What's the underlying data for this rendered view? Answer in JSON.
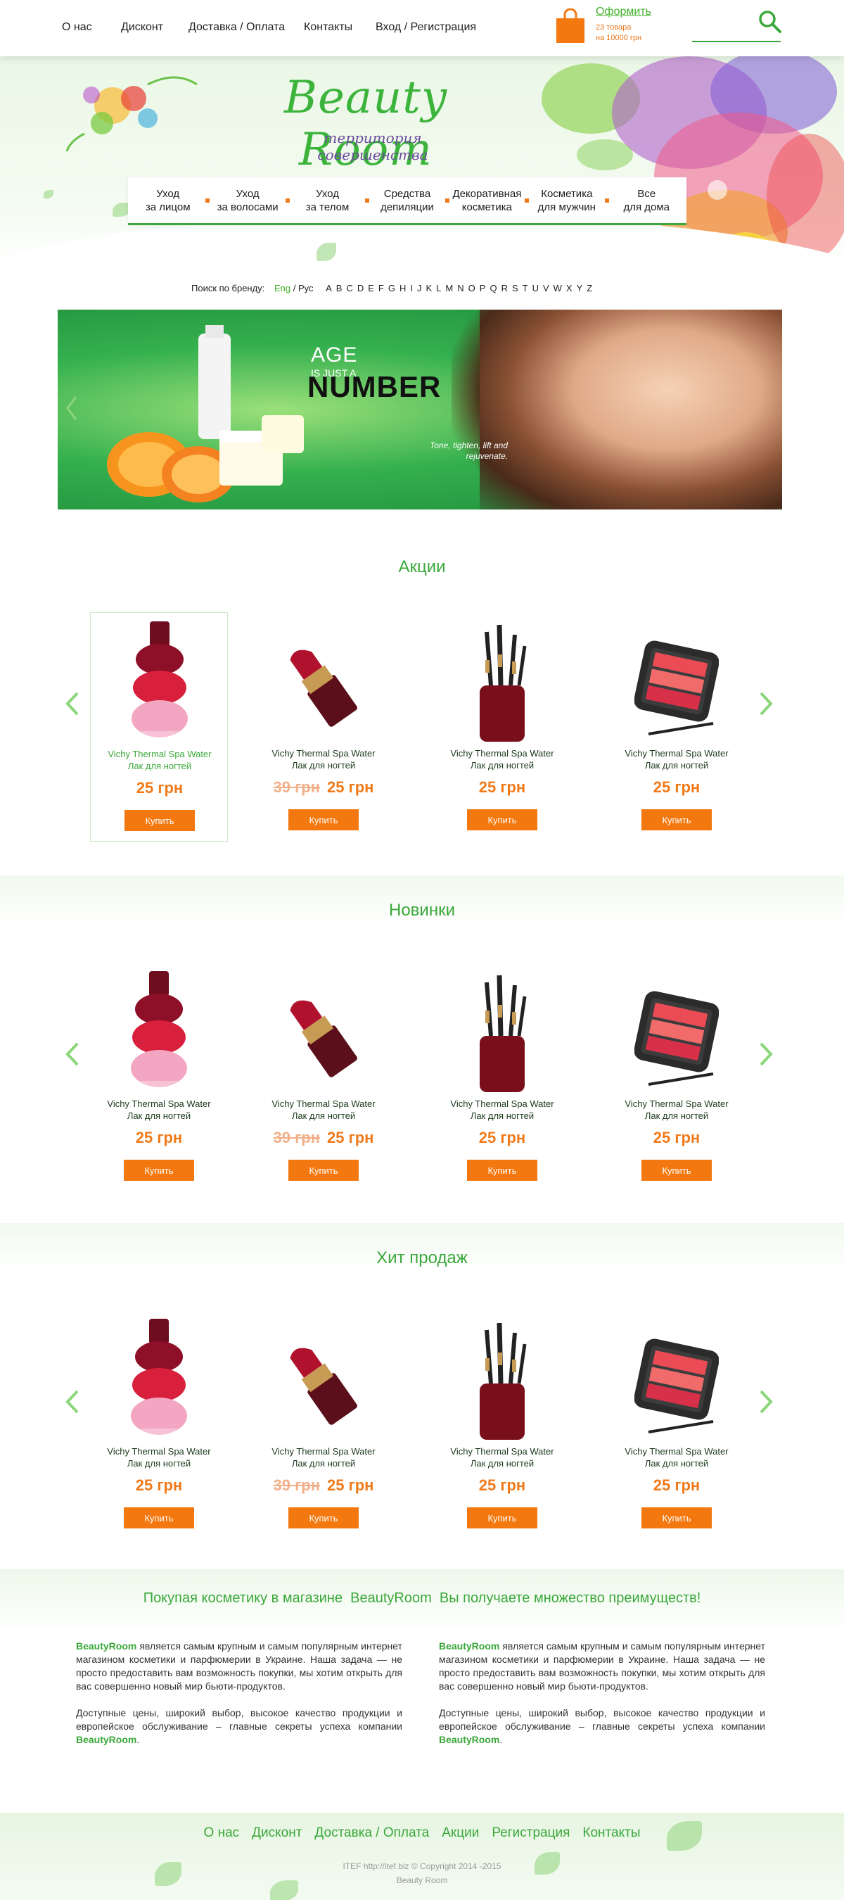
{
  "topnav": {
    "about": "О нас",
    "discount": "Дисконт",
    "delivery": "Доставка / Оплата",
    "contacts": "Контакты",
    "login": "Вход / Регистрация"
  },
  "cart": {
    "checkout": "Оформить",
    "count": "23 товара",
    "total": "на 10000 грн"
  },
  "logo": {
    "title": "Beauty Room",
    "slogan": "территория совершенства"
  },
  "categories": [
    {
      "label": "Уход\nза лицом"
    },
    {
      "label": "Уход\nза волосами"
    },
    {
      "label": "Уход\nза телом"
    },
    {
      "label": "Средства\nдепиляции"
    },
    {
      "label": "Декоративная\nкосметика"
    },
    {
      "label": "Косметика\nдля мужчин"
    },
    {
      "label": "Все\nдля дома"
    }
  ],
  "brand_search": {
    "label": "Поиск по бренду:",
    "eng": "Eng",
    "sep": "/",
    "rus": "Рус",
    "letters": [
      "A",
      "B",
      "C",
      "D",
      "E",
      "F",
      "G",
      "H",
      "I",
      "J",
      "K",
      "L",
      "M",
      "N",
      "O",
      "P",
      "Q",
      "R",
      "S",
      "T",
      "U",
      "V",
      "W",
      "X",
      "Y",
      "Z"
    ]
  },
  "banner": {
    "line1": "AGE",
    "line2": "IS JUST A",
    "line3": "NUMBER",
    "sub": "Tone, tighten, lift and rejuvenate."
  },
  "sections": [
    {
      "title": "Акции",
      "products": [
        {
          "name": "Vichy Thermal Spa Water",
          "type": "Лак для ногтей",
          "old_price": "",
          "price": "25 грн",
          "buy": "Купить",
          "image": "nail-polish-icon"
        },
        {
          "name": "Vichy Thermal Spa Water",
          "type": "Лак для ногтей",
          "old_price": "39 грн",
          "price": "25 грн",
          "buy": "Купить",
          "image": "lipstick-icon"
        },
        {
          "name": "Vichy Thermal Spa Water",
          "type": "Лак для ногтей",
          "old_price": "",
          "price": "25 грн",
          "buy": "Купить",
          "image": "brush-set-icon"
        },
        {
          "name": "Vichy Thermal Spa Water",
          "type": "Лак для ногтей",
          "old_price": "",
          "price": "25 грн",
          "buy": "Купить",
          "image": "palette-icon"
        }
      ]
    },
    {
      "title": "Новинки",
      "products": [
        {
          "name": "Vichy Thermal Spa Water",
          "type": "Лак для ногтей",
          "old_price": "",
          "price": "25 грн",
          "buy": "Купить",
          "image": "nail-polish-icon"
        },
        {
          "name": "Vichy Thermal Spa Water",
          "type": "Лак для ногтей",
          "old_price": "39 грн",
          "price": "25 грн",
          "buy": "Купить",
          "image": "lipstick-icon"
        },
        {
          "name": "Vichy Thermal Spa Water",
          "type": "Лак для ногтей",
          "old_price": "",
          "price": "25 грн",
          "buy": "Купить",
          "image": "brush-set-icon"
        },
        {
          "name": "Vichy Thermal Spa Water",
          "type": "Лак для ногтей",
          "old_price": "",
          "price": "25 грн",
          "buy": "Купить",
          "image": "palette-icon"
        }
      ]
    },
    {
      "title": "Хит продаж",
      "products": [
        {
          "name": "Vichy Thermal Spa Water",
          "type": "Лак для ногтей",
          "old_price": "",
          "price": "25 грн",
          "buy": "Купить",
          "image": "nail-polish-icon"
        },
        {
          "name": "Vichy Thermal Spa Water",
          "type": "Лак для ногтей",
          "old_price": "39 грн",
          "price": "25 грн",
          "buy": "Купить",
          "image": "lipstick-icon"
        },
        {
          "name": "Vichy Thermal Spa Water",
          "type": "Лак для ногтей",
          "old_price": "",
          "price": "25 грн",
          "buy": "Купить",
          "image": "brush-set-icon"
        },
        {
          "name": "Vichy Thermal Spa Water",
          "type": "Лак для ногтей",
          "old_price": "",
          "price": "25 грн",
          "buy": "Купить",
          "image": "palette-icon"
        }
      ]
    }
  ],
  "about": {
    "title_pre": "Покупая косметику в магазине",
    "title_brand": "BeautyRoom",
    "title_post": "Вы получаете множество преимуществ!",
    "col1_brand": "BeautyRoom",
    "col1_p1": " является самым крупным и самым популярным интернет магазином косметики и парфюмерии в Украине. Наша задача — не просто предоставить вам возможность покупки, мы хотим открыть для вас совершенно новый мир бьюти-продуктов.",
    "col1_p2": "Доступные цены, широкий выбор, высокое качество продукции и европейское обслуживание – главные секреты успеха компании ",
    "col1_p2_brand": "BeautyRoom",
    "col1_p2_end": ".",
    "col2_brand": "BeautyRoom",
    "col2_p1": " является самым крупным и самым популярным интернет магазином косметики и парфюмерии в Украине. Наша задача — не просто предоставить вам возможность покупки, мы хотим открыть для вас совершенно новый мир бьюти-продуктов.",
    "col2_p2": "Доступные цены, широкий выбор, высокое качество продукции и европейское обслуживание – главные секреты успеха компании ",
    "col2_p2_brand": "BeautyRoom",
    "col2_p2_end": "."
  },
  "footer": {
    "nav": [
      "О нас",
      "Дисконт",
      "Доставка / Оплата",
      "Акции",
      "Регистрация",
      "Контакты"
    ],
    "credit": "ITEF  http://itef.biz   © Copyright 2014 -2015",
    "brand": "Beauty Room"
  },
  "colors": {
    "accent_green": "#3aa83a",
    "price_orange": "#f07a1a",
    "button_orange": "#f3780f",
    "old_price": "#f2b08a"
  }
}
